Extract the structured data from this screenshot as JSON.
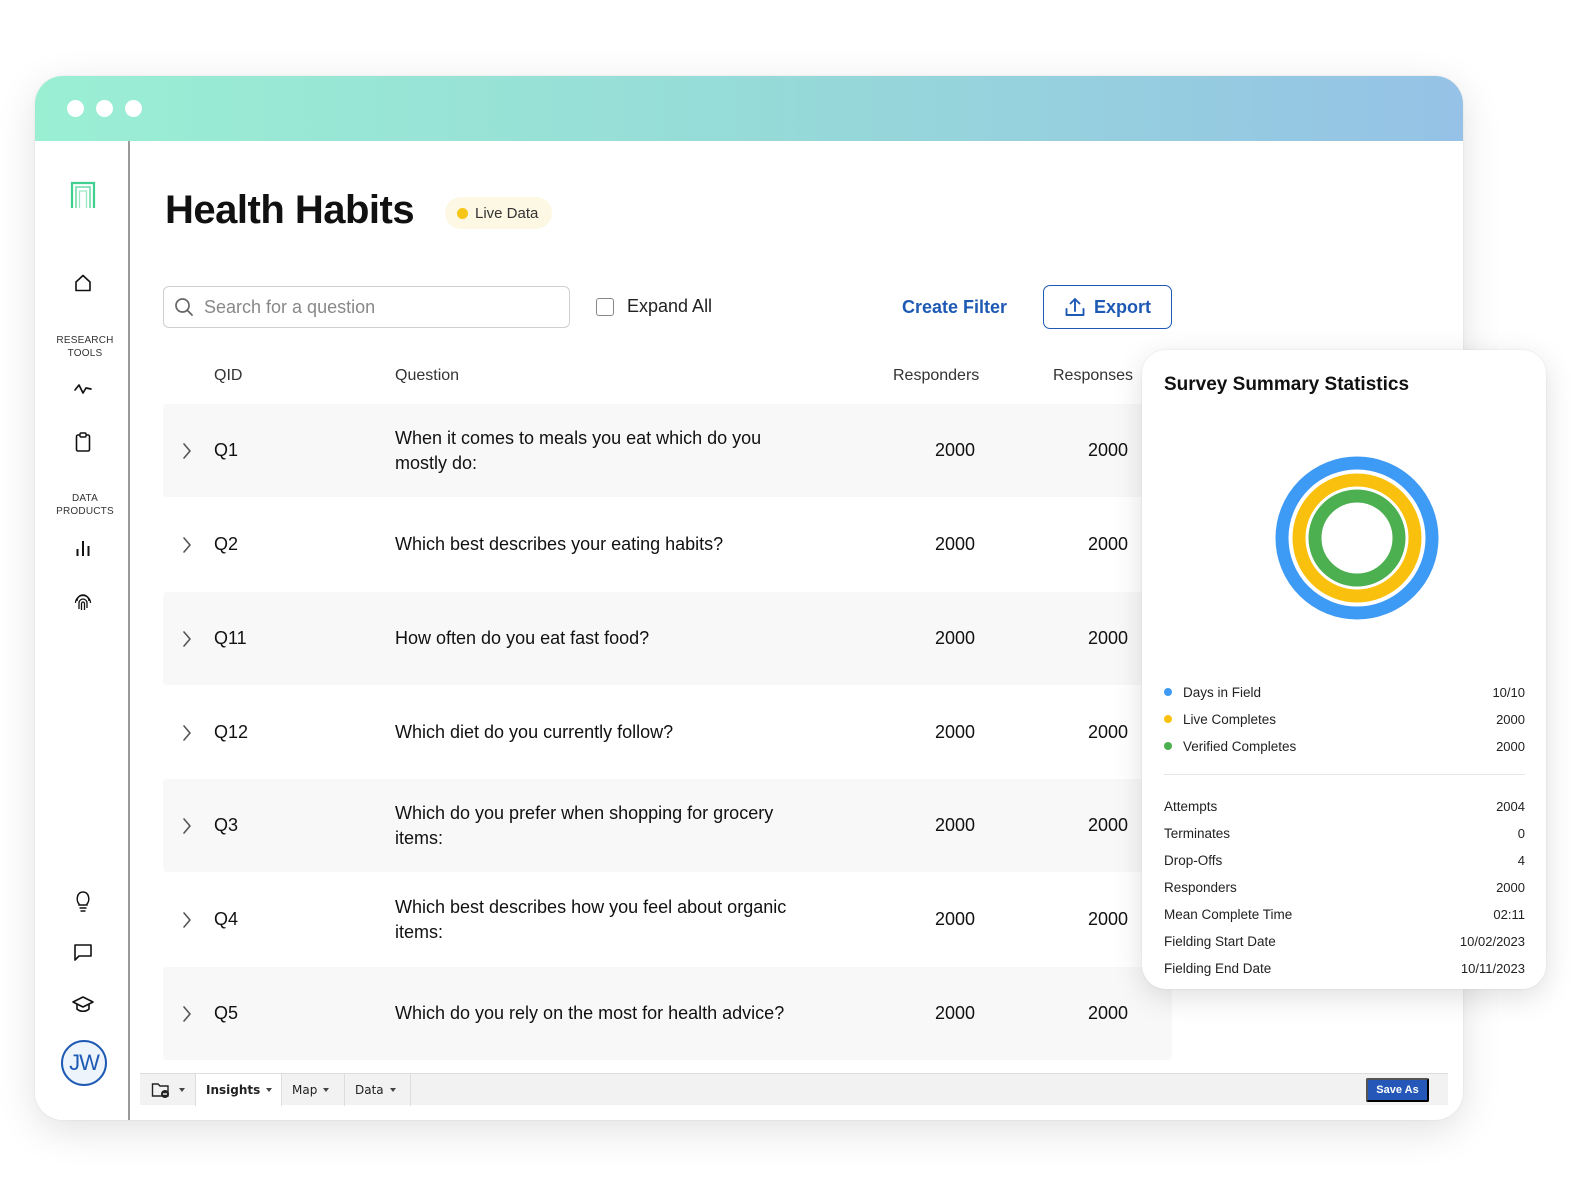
{
  "window": {
    "titlebar_dots": 3
  },
  "sidebar": {
    "logo": "archway-logo",
    "items": [
      {
        "name": "home",
        "icon": "home-icon"
      },
      {
        "section_label_line1": "RESEARCH",
        "section_label_line2": "TOOLS"
      },
      {
        "name": "pulse",
        "icon": "activity-icon"
      },
      {
        "name": "clipboard",
        "icon": "clipboard-icon"
      },
      {
        "section_label_line1": "DATA",
        "section_label_line2": "PRODUCTS"
      },
      {
        "name": "charts",
        "icon": "bar-chart-icon"
      },
      {
        "name": "fingerprint",
        "icon": "fingerprint-icon"
      },
      {
        "name": "ideas",
        "icon": "lightbulb-icon"
      },
      {
        "name": "messages",
        "icon": "chat-icon"
      },
      {
        "name": "learn",
        "icon": "graduation-cap-icon"
      }
    ],
    "avatar_initials": "JW"
  },
  "header": {
    "title": "Health Habits",
    "badge_label": "Live Data",
    "badge_color": "#f5c518"
  },
  "toolbar": {
    "search_placeholder": "Search for a question",
    "search_value": "",
    "expand_all_label": "Expand All",
    "expand_all_checked": false,
    "create_filter_label": "Create Filter",
    "export_label": "Export"
  },
  "table": {
    "columns": [
      "QID",
      "Question",
      "Responders",
      "Responses"
    ],
    "rows": [
      {
        "qid": "Q1",
        "question": "When it comes to meals you eat which do you mostly do:",
        "responders": "2000",
        "responses": "2000"
      },
      {
        "qid": "Q2",
        "question": "Which best describes your eating habits?",
        "responders": "2000",
        "responses": "2000"
      },
      {
        "qid": "Q11",
        "question": "How often do you eat fast food?",
        "responders": "2000",
        "responses": "2000"
      },
      {
        "qid": "Q12",
        "question": "Which diet do you currently follow?",
        "responders": "2000",
        "responses": "2000"
      },
      {
        "qid": "Q3",
        "question": "Which do you prefer when shopping for grocery items:",
        "responders": "2000",
        "responses": "2000"
      },
      {
        "qid": "Q4",
        "question": "Which best describes how you feel about organic items:",
        "responders": "2000",
        "responses": "2000"
      },
      {
        "qid": "Q5",
        "question": "Which do you rely on the most for health advice?",
        "responders": "2000",
        "responses": "2000"
      }
    ]
  },
  "bottom_bar": {
    "tabs": [
      {
        "label": "Insights",
        "active": true
      },
      {
        "label": "Map",
        "active": false
      },
      {
        "label": "Data",
        "active": false
      }
    ],
    "save_as_label": "Save As"
  },
  "summary": {
    "title": "Survey Summary Statistics",
    "legend": [
      {
        "label": "Days in Field",
        "value": "10/10",
        "color": "#3d9af5",
        "fraction": 1.0
      },
      {
        "label": "Live Completes",
        "value": "2000",
        "color": "#f9c10e",
        "fraction": 1.0
      },
      {
        "label": "Verified Completes",
        "value": "2000",
        "color": "#4caf50",
        "fraction": 1.0
      }
    ],
    "stats": [
      {
        "label": "Attempts",
        "value": "2004"
      },
      {
        "label": "Terminates",
        "value": "0"
      },
      {
        "label": "Drop-Offs",
        "value": "4"
      },
      {
        "label": "Responders",
        "value": "2000"
      },
      {
        "label": "Mean Complete Time",
        "value": "02:11"
      },
      {
        "label": "Fielding Start Date",
        "value": "10/02/2023"
      },
      {
        "label": "Fielding End Date",
        "value": "10/11/2023"
      }
    ]
  }
}
